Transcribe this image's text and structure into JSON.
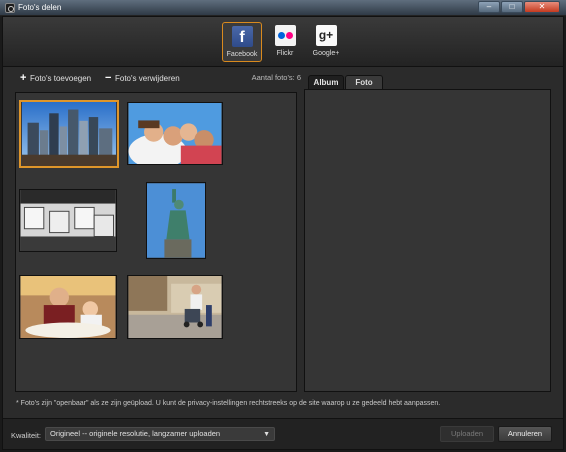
{
  "window": {
    "title": "Foto's delen",
    "controls": {
      "minimize": "–",
      "maximize": "□",
      "close": "✕"
    }
  },
  "share": {
    "options": [
      {
        "label": "Facebook",
        "glyph": "f",
        "active": true,
        "icon": "facebook-icon"
      },
      {
        "label": "Flickr",
        "active": false,
        "icon": "flickr-icon"
      },
      {
        "label": "Google+",
        "glyph": "g+",
        "active": false,
        "icon": "google-plus-icon"
      }
    ]
  },
  "toolbar": {
    "add_label": "Foto's toevoegen",
    "remove_label": "Foto's verwijderen",
    "count_label": "Aantal foto's: 6"
  },
  "photos": [
    {
      "name": "city-skyline",
      "selected": true
    },
    {
      "name": "group-selfie",
      "selected": false
    },
    {
      "name": "cafe-chairs",
      "selected": false
    },
    {
      "name": "statue-of-liberty",
      "selected": false
    },
    {
      "name": "restaurant-mother-child",
      "selected": false
    },
    {
      "name": "street-stroller",
      "selected": false
    }
  ],
  "tabs": {
    "album": "Album",
    "foto": "Foto"
  },
  "notice": "* Foto's zijn \"openbaar\" als ze zijn geüpload. U kunt de privacy-instellingen rechtstreeks op de site waarop u ze gedeeld hebt aanpassen.",
  "footer": {
    "quality_label": "Kwaliteit:",
    "quality_value": "Origineel -- originele resolutie, langzamer uploaden",
    "upload_label": "Uploaden",
    "cancel_label": "Annuleren"
  },
  "colors": {
    "accent": "#e0962a",
    "background": "#2b2b2b",
    "panel": "#353535"
  }
}
